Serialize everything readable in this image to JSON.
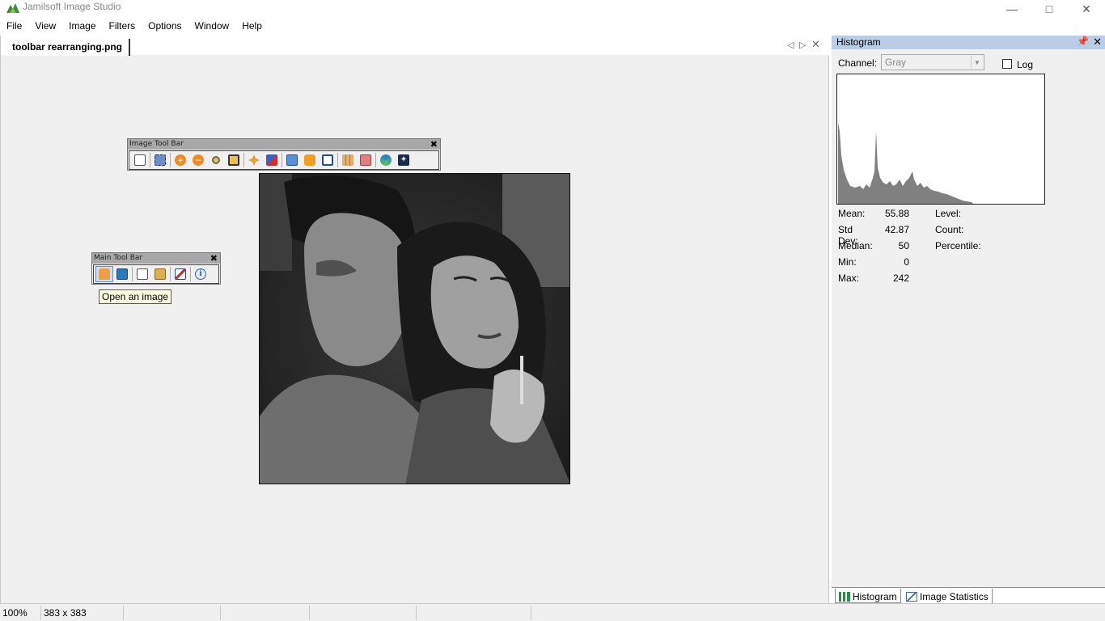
{
  "window": {
    "title": "Jamilsoft Image Studio"
  },
  "menu": [
    "File",
    "View",
    "Image",
    "Filters",
    "Options",
    "Window",
    "Help"
  ],
  "document": {
    "tab_label": "toolbar rearranging.png"
  },
  "image_toolbar": {
    "title": "Image Tool Bar",
    "buttons": [
      "copy-icon",
      "select-icon",
      "zoom-in-icon",
      "zoom-out-icon",
      "zoom-icon",
      "fit-icon",
      "move-icon",
      "swap-icon",
      "image-icon",
      "color-icon",
      "frame-icon",
      "grid-icon",
      "blend-icon",
      "circle-icon",
      "sparkle-icon"
    ]
  },
  "main_toolbar": {
    "title": "Main Tool Bar",
    "buttons": [
      "open-icon",
      "save-icon",
      "copy-icon",
      "paste-icon",
      "image-icon",
      "info-icon"
    ]
  },
  "tooltip": "Open an image",
  "histogram_panel": {
    "title": "Histogram",
    "channel_label": "Channel:",
    "channel_value": "Gray",
    "log_label": "Log",
    "log_checked": false,
    "stats": {
      "mean_label": "Mean:",
      "mean": "55.88",
      "stddev_label": "Std Dev:",
      "stddev": "42.87",
      "median_label": "Median:",
      "median": "50",
      "min_label": "Min:",
      "min": "0",
      "max_label": "Max:",
      "max": "242",
      "level_label": "Level:",
      "count_label": "Count:",
      "percentile_label": "Percentile:"
    },
    "bottom_tabs": [
      "Histogram",
      "Image Statistics"
    ]
  },
  "status_bar": {
    "zoom": "100%",
    "size": "383 x 383"
  },
  "colors": {
    "panel_title": "#b9cde5",
    "histogram_fill": "#808080",
    "tooltip_bg": "#ffffe1"
  }
}
